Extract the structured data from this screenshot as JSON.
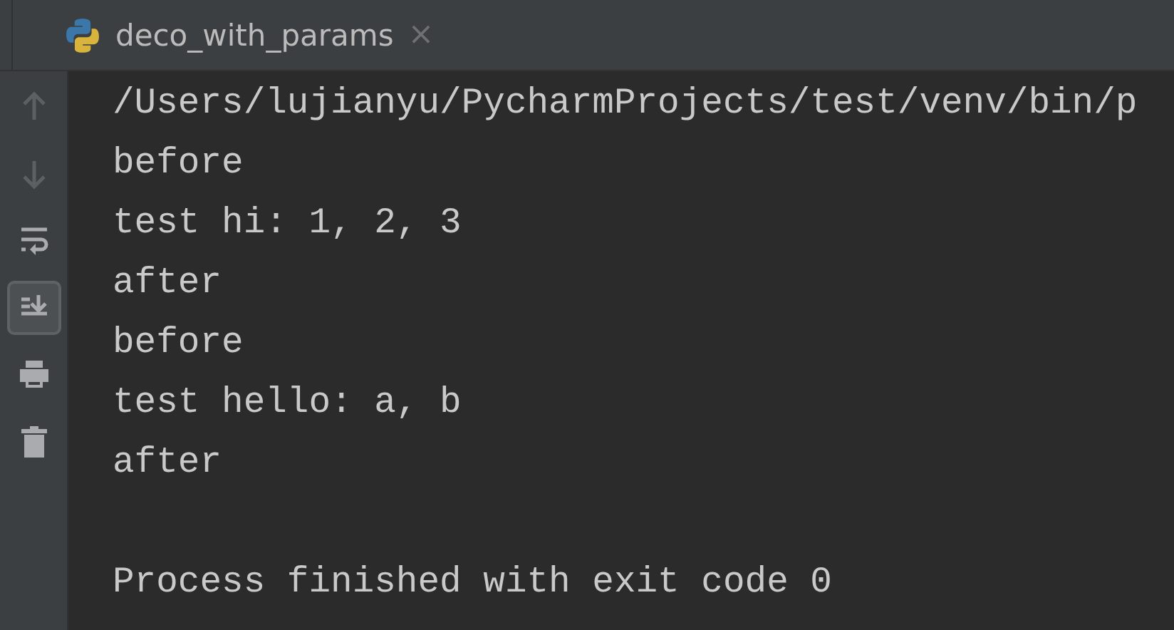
{
  "tab": {
    "title": "deco_with_params",
    "close": "×"
  },
  "toolbar": [
    {
      "kind": "up",
      "disabled": true,
      "selected": false
    },
    {
      "kind": "down",
      "disabled": true,
      "selected": false
    },
    {
      "kind": "wrap",
      "disabled": false,
      "selected": false
    },
    {
      "kind": "scroll",
      "disabled": false,
      "selected": true
    },
    {
      "kind": "print",
      "disabled": false,
      "selected": false
    },
    {
      "kind": "trash",
      "disabled": false,
      "selected": false
    }
  ],
  "console": {
    "lines": [
      "/Users/lujianyu/PycharmProjects/test/venv/bin/p",
      "before",
      "test hi: 1, 2, 3",
      "after",
      "before",
      "test hello: a, b",
      "after"
    ],
    "exit_message": "Process finished with exit code 0"
  }
}
